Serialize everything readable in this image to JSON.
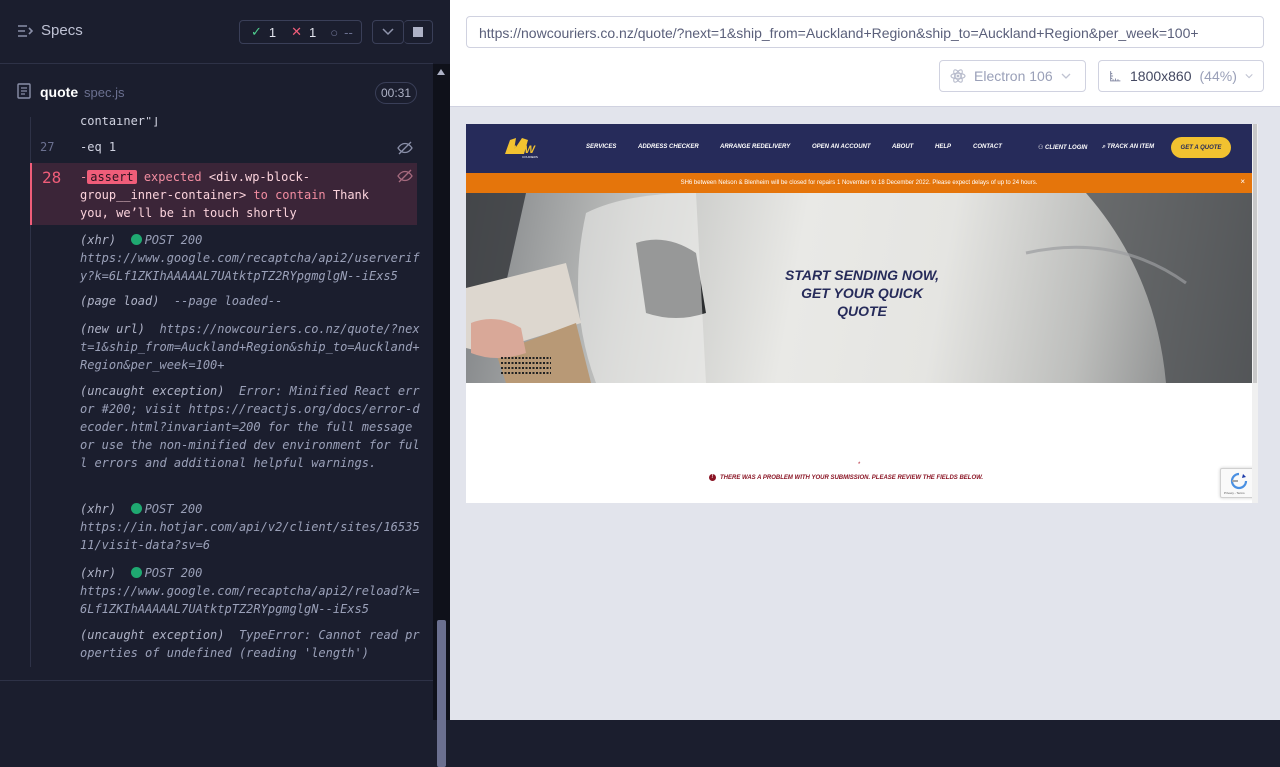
{
  "reporter": {
    "specs_label": "Specs",
    "stats": {
      "passed": "1",
      "failed": "1",
      "pending": "--"
    },
    "spec": {
      "name": "quote",
      "ext": "spec.js",
      "duration": "00:31"
    },
    "commands": [
      {
        "num": "",
        "name": "container\"]"
      },
      {
        "num": "27",
        "name": "-eq  1"
      }
    ],
    "failure": {
      "num": "28",
      "prefix": "-",
      "tag": "assert",
      "text1": " expected ",
      "code1": "<div.wp-block-group__inner-container>",
      "text2": " to contain ",
      "code2": "Thank you, we’ll be in touch shortly"
    },
    "logs": [
      {
        "kind": "(xhr)",
        "status": "POST 200",
        "text": "https://www.google.com/recaptcha/api2/userverify?k=6Lf1ZKIhAAAAAL7UAtktpTZ2RYpgmglgN--iExs5"
      },
      {
        "kind": "(page load)",
        "status": "",
        "text": "--page loaded--"
      },
      {
        "kind": "(new url)",
        "status": "",
        "text": "https://nowcouriers.co.nz/quote/?next=1&ship_from=Auckland+Region&ship_to=Auckland+Region&per_week=100+"
      },
      {
        "kind": "(uncaught exception)",
        "status": "",
        "text": "Error: Minified React error #200; visit https://reactjs.org/docs/error-decoder.html?invariant=200 for the full message or use the non-minified dev environment for full errors and additional helpful warnings."
      },
      {
        "kind": "(xhr)",
        "status": "POST 200",
        "text": "https://in.hotjar.com/api/v2/client/sites/1653511/visit-data?sv=6"
      },
      {
        "kind": "(xhr)",
        "status": "POST 200",
        "text": "https://www.google.com/recaptcha/api2/reload?k=6Lf1ZKIhAAAAAL7UAtktpTZ2RYpgmglgN--iExs5"
      },
      {
        "kind": "(uncaught exception)",
        "status": "",
        "text": "TypeError: Cannot read properties of undefined (reading 'length')"
      }
    ]
  },
  "browser": {
    "url": "https://nowcouriers.co.nz/quote/?next=1&ship_from=Auckland+Region&ship_to=Auckland+Region&per_week=100+",
    "engine": "Electron 106",
    "viewport": "1800x860",
    "zoom": "(44%)"
  },
  "aut": {
    "logo_text": "NOW",
    "logo_sub": "COURIERS",
    "nav": [
      "SERVICES",
      "ADDRESS CHECKER",
      "ARRANGE REDELIVERY",
      "OPEN AN ACCOUNT",
      "ABOUT",
      "HELP",
      "CONTACT"
    ],
    "client_login": "CLIENT LOGIN",
    "track": "TRACK AN ITEM",
    "quote_button": "GET A QUOTE",
    "alert": "SH6 between Nelson & Blenheim will be closed for repairs 1 November to 18 December 2022. Please expect delays of up to 24 hours.",
    "alert_close": "×",
    "hero_line1": "START SENDING NOW,",
    "hero_line2": "GET YOUR QUICK QUOTE",
    "error_star": "*",
    "error_message": "THERE WAS A PROBLEM WITH YOUR SUBMISSION. PLEASE REVIEW THE FIELDS BELOW.",
    "recaptcha_text": "Privacy - Terms"
  },
  "colors": {
    "brand_navy": "#262b5a",
    "brand_yellow": "#f2c230",
    "alert_orange": "#e5750b",
    "fail_red": "#f05d79",
    "pass_green": "#4fcf8f"
  }
}
